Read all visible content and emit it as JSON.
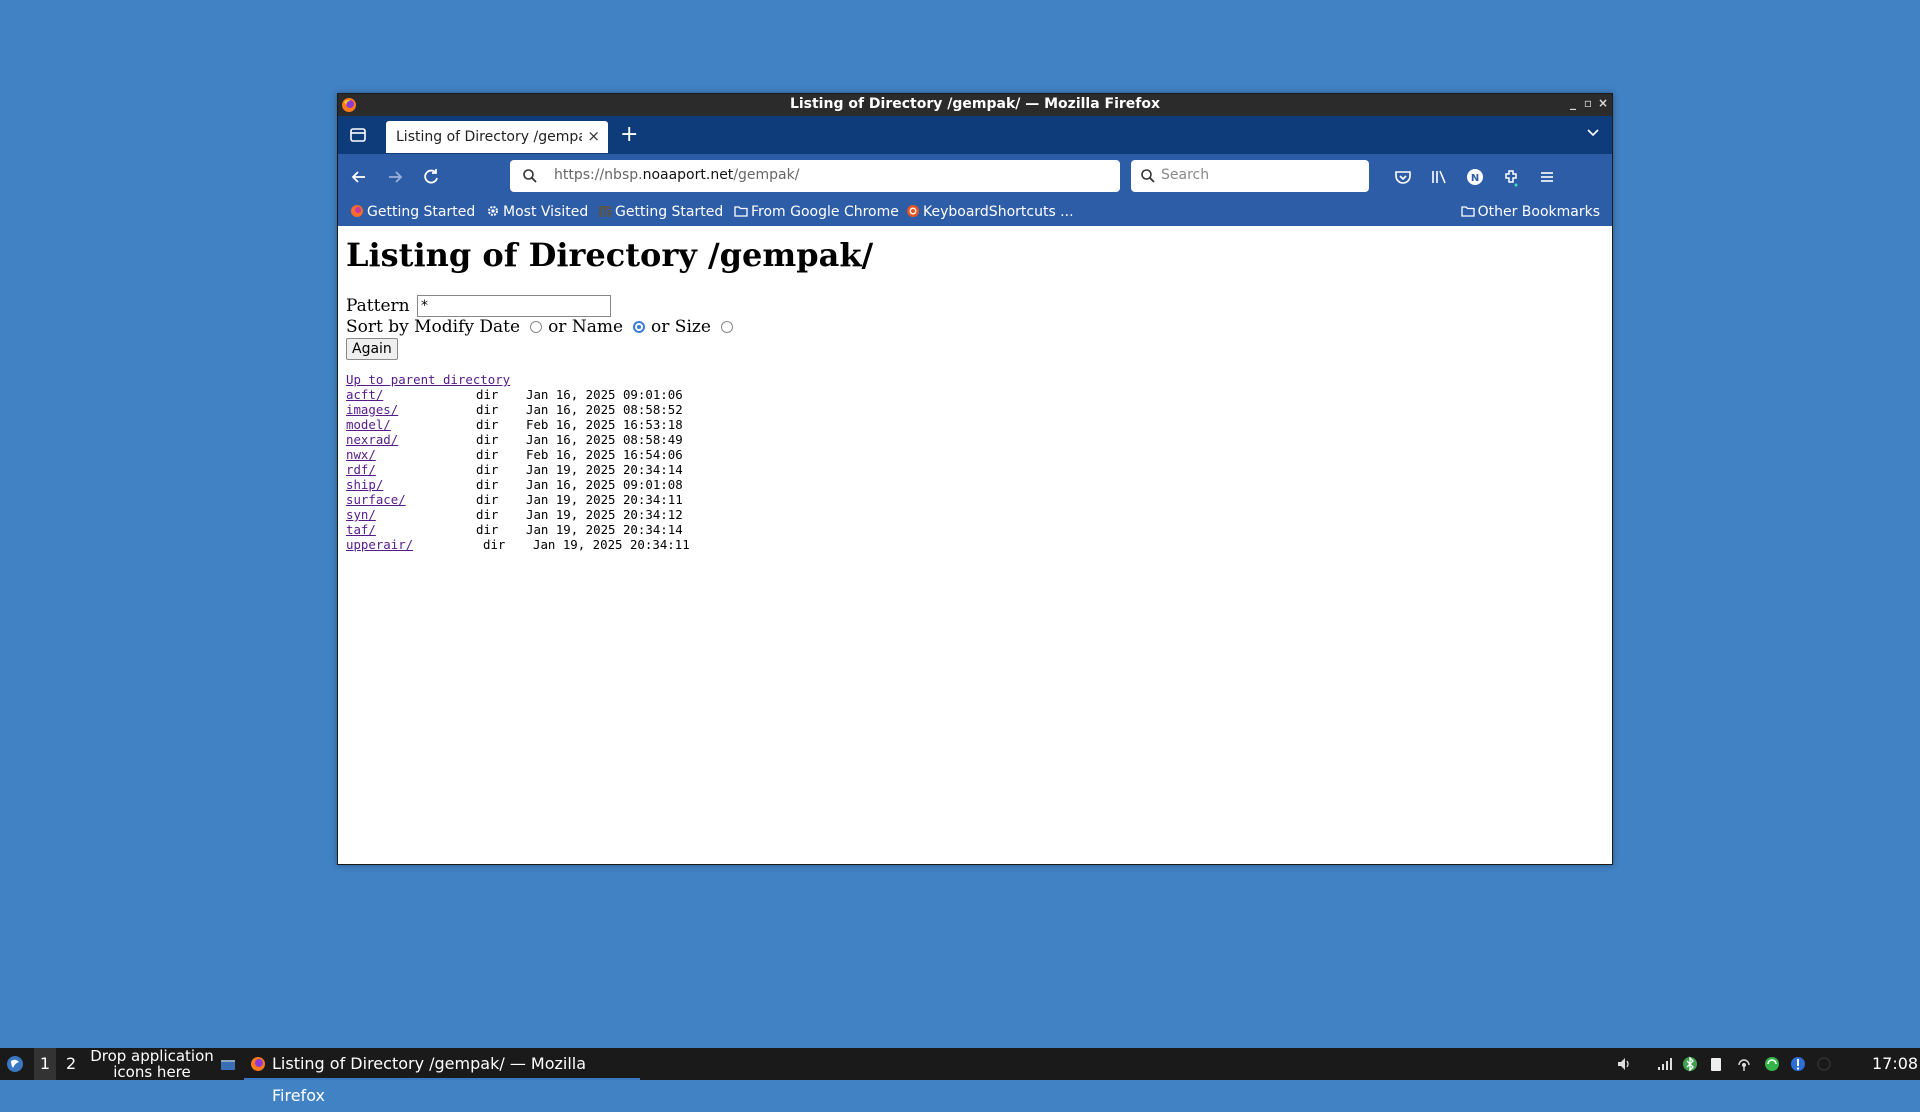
{
  "window": {
    "title": "Listing of Directory /gempak/ — Mozilla Firefox",
    "controls": [
      "_",
      "▫",
      "×"
    ]
  },
  "tab": {
    "title": "Listing of Directory /gempak/",
    "close": "×",
    "new": "+"
  },
  "nav": {
    "url_prefix": "https://nbsp.",
    "url_domain": "noaaport.net",
    "url_path": "/gempak/",
    "search_placeholder": "Search"
  },
  "bookmarks": {
    "items": [
      "Getting Started",
      "Most Visited",
      "Getting Started",
      "From Google Chrome",
      "KeyboardShortcuts ..."
    ],
    "other": "Other Bookmarks"
  },
  "page": {
    "heading": "Listing of Directory /gempak/",
    "pattern_label": "Pattern",
    "pattern_value": "*",
    "sort_label": "Sort by Modify Date",
    "or_name": "or Name",
    "or_size": "or Size",
    "sort_selected": "name",
    "again": "Again",
    "parent_link": "Up to parent directory",
    "entries": [
      {
        "name": "acft/",
        "type": "dir",
        "date": "Jan 16, 2025 09:01:06"
      },
      {
        "name": "images/",
        "type": "dir",
        "date": "Jan 16, 2025 08:58:52"
      },
      {
        "name": "model/",
        "type": "dir",
        "date": "Feb 16, 2025 16:53:18"
      },
      {
        "name": "nexrad/",
        "type": "dir",
        "date": "Jan 16, 2025 08:58:49"
      },
      {
        "name": "nwx/",
        "type": "dir",
        "date": "Feb 16, 2025 16:54:06"
      },
      {
        "name": "rdf/",
        "type": "dir",
        "date": "Jan 19, 2025 20:34:14"
      },
      {
        "name": "ship/",
        "type": "dir",
        "date": "Jan 16, 2025 09:01:08"
      },
      {
        "name": "surface/",
        "type": "dir",
        "date": "Jan 19, 2025 20:34:11"
      },
      {
        "name": "syn/",
        "type": "dir",
        "date": "Jan 19, 2025 20:34:12"
      },
      {
        "name": "taf/",
        "type": "dir",
        "date": "Jan 19, 2025 20:34:14"
      },
      {
        "name": "upperair/",
        "type": "dir",
        "date": "Jan 19, 2025 20:34:11"
      }
    ]
  },
  "taskbar": {
    "workspace1": "1",
    "workspace2": "2",
    "drop_line1": "Drop application",
    "drop_line2": "icons here",
    "task_title": "Listing of Directory /gempak/ — Mozilla Firefox",
    "clock": "17:08"
  },
  "colors": {
    "desktop": "#4182c4",
    "tabbar": "#0e3c7a",
    "toolbar": "#2e5da8",
    "link_visited": "#551a8b"
  }
}
